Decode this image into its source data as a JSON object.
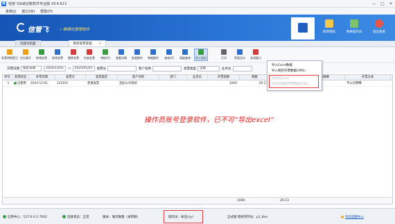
{
  "window": {
    "title": "信管飞出纳记账软件专业版 V9.4.613",
    "controls": [
      "—",
      "□",
      "✕"
    ]
  },
  "menu": [
    "系统(J)",
    "窗口(W)",
    "帮助(H)"
  ],
  "banner": {
    "brand": "信管飞",
    "slogan": "• 精细化管理软件",
    "tools": [
      {
        "label": "",
        "icon": "document-icon"
      },
      {
        "label": "修改密码",
        "icon": "key-icon"
      },
      {
        "label": "更换操作员",
        "icon": "users-icon"
      },
      {
        "label": "退出系统",
        "icon": "exit-icon"
      }
    ]
  },
  "tabs": [
    {
      "label": "功能导航面"
    },
    {
      "label": "销项发票管理",
      "close": "×"
    }
  ],
  "toolbar": [
    {
      "label": "发票明细登记",
      "color": "#e8a21a"
    },
    {
      "label": "空白填开",
      "color": "#e8a21a"
    },
    {
      "label": "新增发票",
      "color": "#3a9b45"
    },
    {
      "label": "修改发票",
      "color": "#2f6fc9"
    },
    {
      "label": "删除发票",
      "color": "#d23c3c"
    },
    {
      "label": "作废发票",
      "color": "#d23c3c"
    },
    {
      "label": "审核(A)",
      "color": "#3a9b45"
    },
    {
      "label": "查看详情",
      "color": "#2f6fc9"
    },
    {
      "label": "批量操作",
      "color": "#2f6fc9"
    },
    {
      "label": "单据操作",
      "color": "#2f6fc9"
    },
    {
      "label": "查询(Z)",
      "color": "#2f6fc9"
    },
    {
      "label": "高级查询",
      "color": "#2f6fc9"
    },
    {
      "label": "导入导出",
      "color": "#3a9b45"
    },
    {
      "label": "打印",
      "color": "#666666"
    },
    {
      "label": "界面设计",
      "color": "#2f6fc9"
    },
    {
      "label": "关闭窗口",
      "color": "#d23c3c"
    }
  ],
  "dropdown": {
    "items": [
      {
        "label": "导入Excel数据",
        "enabled": true
      },
      {
        "label": "导入税控开票数据(XML)",
        "enabled": true
      },
      {
        "label": "导出为Excel",
        "enabled": false
      },
      {
        "label": "导出为税控开票数据(XML)",
        "enabled": false
      }
    ]
  },
  "filters": {
    "date_label": "开票日期",
    "date_mode": "指定日期",
    "date_from": "2024/12/01",
    "date_to_sep": "～",
    "date_to": "2025/01/01",
    "invoice_no_label": "发票号",
    "invoice_no_value": "",
    "customer_label": "客户名称",
    "customer_value": "",
    "type_label": "发票类型",
    "type_value": "全部",
    "staff_label": "业务员",
    "staff_value": "",
    "query_button": "查询",
    "advanced_button": "高级查询"
  },
  "table": {
    "columns": [
      "序号",
      "发票状态",
      "开票日期",
      "发票号",
      "发票类型",
      "客户名称",
      "部门",
      "业务员",
      "开票金额",
      "税额",
      "价税合计",
      "业务摘要",
      "开票方式"
    ],
    "rows": [
      [
        "1",
        "已使用",
        "2024-12-01",
        "122101",
        "普通发票",
        "丑纪公司测试",
        "",
        "",
        "1000",
        "29.13",
        "",
        "",
        "不公记明细"
      ]
    ],
    "footer": {
      "amount": "1000",
      "tax": "29.13"
    }
  },
  "annotation": "操作员账号登录软件，已不可“导出excel”",
  "status": {
    "connection": "信用中心：127.0.0.1:7002",
    "connect_state": "连接状态：正常",
    "edition": "版本：满示数量（录用频）",
    "operator": "操作员：徐丑(xy)",
    "license": "正式版  授权序列号：p1_8ex",
    "message_link": "消息提醒中心"
  },
  "colors": {
    "accent": "#1f5fbf",
    "annotation": "#e0211f",
    "ok": "#3aa14a"
  }
}
